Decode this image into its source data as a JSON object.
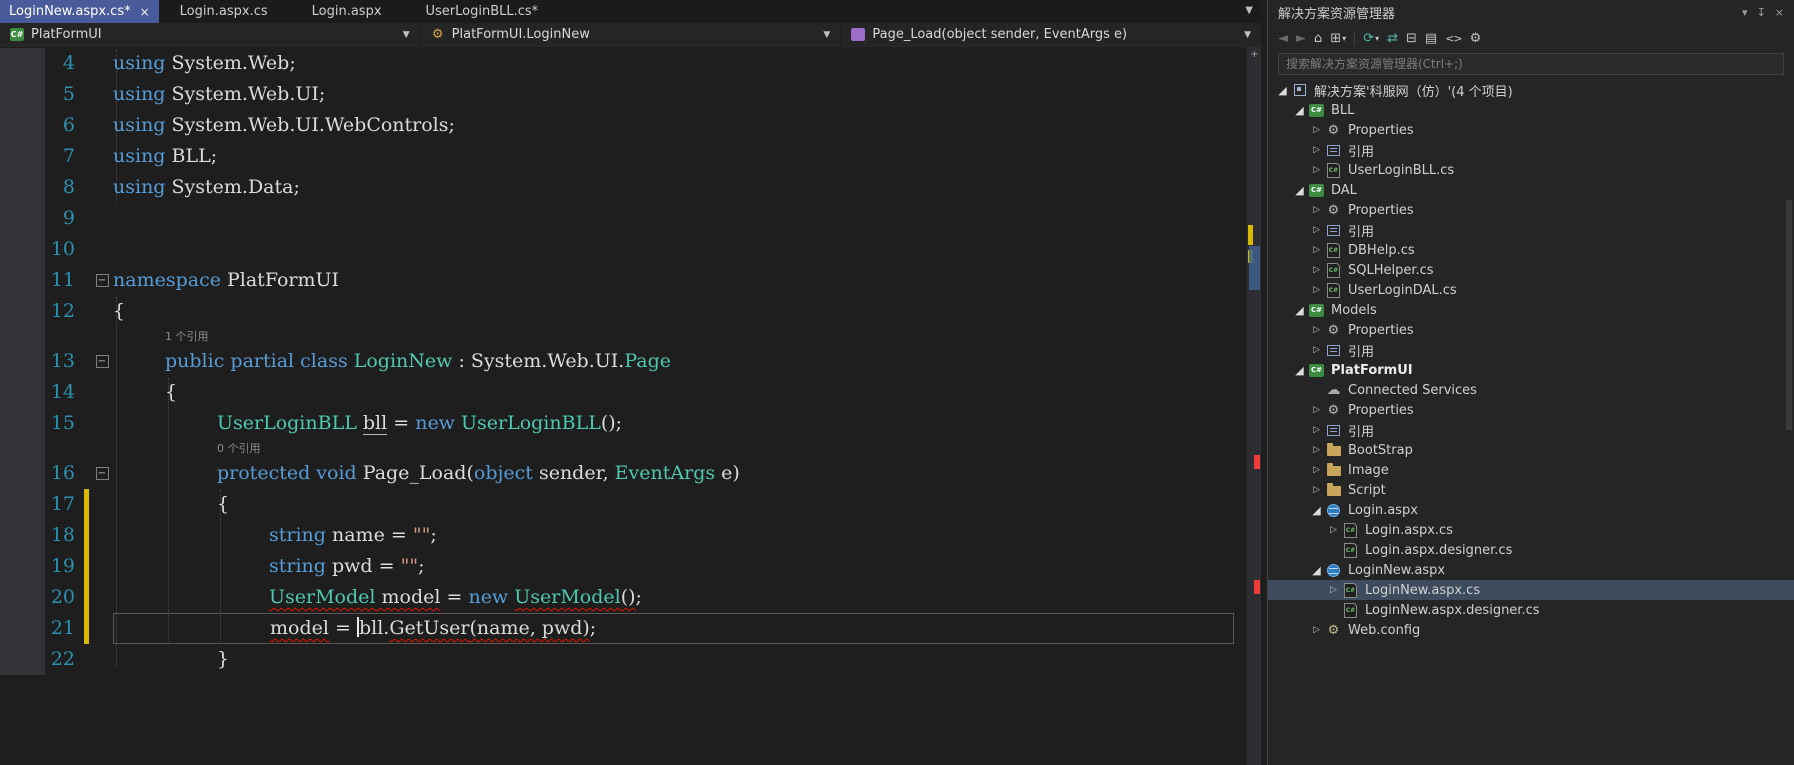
{
  "tabs": {
    "close_glyph": "×",
    "overflow_glyph": "▼",
    "items": [
      {
        "label": "LoginNew.aspx.cs*",
        "active": true
      },
      {
        "label": "Login.aspx.cs",
        "active": false
      },
      {
        "label": "Login.aspx",
        "active": false
      },
      {
        "label": "UserLoginBLL.cs*",
        "active": false
      }
    ]
  },
  "breadcrumbs": [
    {
      "label": "PlatFormUI",
      "icon": "project",
      "icon_glyph": "C#"
    },
    {
      "label": "PlatFormUI.LoginNew",
      "icon": "class",
      "icon_glyph": "⚙"
    },
    {
      "label": "Page_Load(object sender, EventArgs e)",
      "icon": "method",
      "icon_glyph": ""
    }
  ],
  "glyphs": {
    "chevron_down": "▼",
    "mini_caret": "▾",
    "expanded": "◢",
    "collapsed": "▷",
    "fold_minus": "−",
    "scroll_widget": "+"
  },
  "editor": {
    "lines": [
      {
        "num": 4,
        "indent": 0,
        "tokens": [
          [
            "kw",
            "using"
          ],
          [
            "pl",
            " System.Web;"
          ]
        ]
      },
      {
        "num": 5,
        "indent": 0,
        "tokens": [
          [
            "kw",
            "using"
          ],
          [
            "pl",
            " System.Web.UI;"
          ]
        ]
      },
      {
        "num": 6,
        "indent": 0,
        "tokens": [
          [
            "kw",
            "using"
          ],
          [
            "pl",
            " System.Web.UI.WebControls;"
          ]
        ]
      },
      {
        "num": 7,
        "indent": 0,
        "tokens": [
          [
            "kw",
            "using"
          ],
          [
            "pl",
            " BLL;"
          ]
        ]
      },
      {
        "num": 8,
        "indent": 0,
        "tokens": [
          [
            "kw",
            "using"
          ],
          [
            "pl",
            " System.Data;"
          ]
        ]
      },
      {
        "num": 9,
        "indent": 0,
        "tokens": []
      },
      {
        "num": 10,
        "indent": 0,
        "tokens": []
      },
      {
        "num": 11,
        "indent": 0,
        "fold": true,
        "tokens": [
          [
            "kw",
            "namespace"
          ],
          [
            "pl",
            " PlatFormUI"
          ]
        ]
      },
      {
        "num": 12,
        "indent": 0,
        "tokens": [
          [
            "pl",
            "{"
          ]
        ]
      },
      {
        "num": 13,
        "indent": 1,
        "fold": true,
        "codelens": "1 个引用",
        "tokens": [
          [
            "kw",
            "public"
          ],
          [
            "pl",
            " "
          ],
          [
            "kw",
            "partial"
          ],
          [
            "pl",
            " "
          ],
          [
            "kw",
            "class"
          ],
          [
            "pl",
            " "
          ],
          [
            "ty",
            "LoginNew"
          ],
          [
            "pl",
            " : System.Web.UI."
          ],
          [
            "ty",
            "Page"
          ]
        ]
      },
      {
        "num": 14,
        "indent": 1,
        "tokens": [
          [
            "pl",
            "{"
          ]
        ]
      },
      {
        "num": 15,
        "indent": 2,
        "tokens": [
          [
            "ty",
            "UserLoginBLL"
          ],
          [
            "pl",
            " "
          ],
          [
            "pl hl",
            "bll"
          ],
          [
            "pl",
            " = "
          ],
          [
            "kw",
            "new"
          ],
          [
            "pl",
            " "
          ],
          [
            "ty",
            "UserLoginBLL"
          ],
          [
            "pl",
            "();"
          ]
        ]
      },
      {
        "num": 16,
        "indent": 2,
        "fold": true,
        "codelens": "0 个引用",
        "tokens": [
          [
            "kw",
            "protected"
          ],
          [
            "pl",
            " "
          ],
          [
            "kw",
            "void"
          ],
          [
            "pl",
            " Page_Load("
          ],
          [
            "kw",
            "object"
          ],
          [
            "pl",
            " sender, "
          ],
          [
            "ty",
            "EventArgs"
          ],
          [
            "pl",
            " e)"
          ]
        ]
      },
      {
        "num": 17,
        "indent": 2,
        "changed": true,
        "tokens": [
          [
            "pl",
            "{"
          ]
        ]
      },
      {
        "num": 18,
        "indent": 3,
        "changed": true,
        "tokens": [
          [
            "kw",
            "string"
          ],
          [
            "pl",
            " name = "
          ],
          [
            "st",
            "\"\""
          ],
          [
            "pl",
            ";"
          ]
        ]
      },
      {
        "num": 19,
        "indent": 3,
        "changed": true,
        "tokens": [
          [
            "kw",
            "string"
          ],
          [
            "pl",
            " pwd = "
          ],
          [
            "st",
            "\"\""
          ],
          [
            "pl",
            ";"
          ]
        ]
      },
      {
        "num": 20,
        "indent": 3,
        "changed": true,
        "tokens": [
          [
            "ty err",
            "UserModel"
          ],
          [
            "pl err",
            " model"
          ],
          [
            "pl",
            " = "
          ],
          [
            "kw",
            "new"
          ],
          [
            "pl",
            " "
          ],
          [
            "ty err",
            "UserModel"
          ],
          [
            "pl err",
            "()"
          ],
          [
            "pl",
            ";"
          ]
        ]
      },
      {
        "num": 21,
        "indent": 3,
        "changed": true,
        "current": true,
        "tokens": [
          [
            "pl err",
            "model"
          ],
          [
            "pl",
            " = "
          ],
          [
            "caret",
            ""
          ],
          [
            "pl",
            "bll."
          ],
          [
            "pl err",
            "GetUser"
          ],
          [
            "pl err",
            "(name, pwd)"
          ],
          [
            "pl",
            ";"
          ]
        ]
      },
      {
        "num": 22,
        "indent": 2,
        "tokens": [
          [
            "pl",
            "}"
          ]
        ]
      }
    ]
  },
  "solution_explorer": {
    "title": "解决方案资源管理器",
    "search_placeholder": "搜索解决方案资源管理器(Ctrl+;)",
    "title_icons": [
      {
        "name": "chevron-down",
        "glyph": "▾"
      },
      {
        "name": "pin",
        "glyph": "↧"
      },
      {
        "name": "close",
        "glyph": "×"
      }
    ],
    "toolbar": [
      {
        "name": "back",
        "glyph": "◄",
        "style": "dim"
      },
      {
        "name": "forward",
        "glyph": "►",
        "style": "dim"
      },
      {
        "name": "home",
        "glyph": "⌂"
      },
      {
        "name": "switch-views",
        "glyph": "⊞",
        "caret": true
      },
      {
        "separator": true
      },
      {
        "name": "refresh",
        "glyph": "⟳",
        "style": "teal",
        "caret": true
      },
      {
        "name": "sync-with-active-document",
        "glyph": "⇄",
        "style": "teal"
      },
      {
        "name": "collapse-all",
        "glyph": "⊟"
      },
      {
        "name": "show-all-files",
        "glyph": "▤"
      },
      {
        "name": "code-view",
        "glyph": "<>",
        "style": "codeview"
      },
      {
        "name": "properties",
        "glyph": "⚙"
      }
    ],
    "icon_glyphs": {
      "csproj": "C#",
      "webproj": "C#",
      "csfile": "C#",
      "properties": "⚙",
      "config": "⚙",
      "cloud": "☁"
    },
    "tree": [
      {
        "label": "解决方案'科服网（仿）'(4 个项目)",
        "indent": 0,
        "expand": "expanded",
        "icon": "solution"
      },
      {
        "label": "BLL",
        "indent": 1,
        "expand": "expanded",
        "icon": "csproj"
      },
      {
        "label": "Properties",
        "indent": 2,
        "expand": "collapsed",
        "icon": "properties"
      },
      {
        "label": "引用",
        "indent": 2,
        "expand": "collapsed",
        "icon": "references"
      },
      {
        "label": "UserLoginBLL.cs",
        "indent": 2,
        "expand": "collapsed",
        "icon": "csfile"
      },
      {
        "label": "DAL",
        "indent": 1,
        "expand": "expanded",
        "icon": "csproj"
      },
      {
        "label": "Properties",
        "indent": 2,
        "expand": "collapsed",
        "icon": "properties"
      },
      {
        "label": "引用",
        "indent": 2,
        "expand": "collapsed",
        "icon": "references"
      },
      {
        "label": "DBHelp.cs",
        "indent": 2,
        "expand": "collapsed",
        "icon": "csfile"
      },
      {
        "label": "SQLHelper.cs",
        "indent": 2,
        "expand": "collapsed",
        "icon": "csfile"
      },
      {
        "label": "UserLoginDAL.cs",
        "indent": 2,
        "expand": "collapsed",
        "icon": "csfile"
      },
      {
        "label": "Models",
        "indent": 1,
        "expand": "expanded",
        "icon": "csproj"
      },
      {
        "label": "Properties",
        "indent": 2,
        "expand": "collapsed",
        "icon": "properties"
      },
      {
        "label": "引用",
        "indent": 2,
        "expand": "collapsed",
        "icon": "references"
      },
      {
        "label": "PlatFormUI",
        "indent": 1,
        "expand": "expanded",
        "icon": "webproj",
        "bold": true
      },
      {
        "label": "Connected Services",
        "indent": 2,
        "expand": null,
        "icon": "cloud"
      },
      {
        "label": "Properties",
        "indent": 2,
        "expand": "collapsed",
        "icon": "properties"
      },
      {
        "label": "引用",
        "indent": 2,
        "expand": "collapsed",
        "icon": "references"
      },
      {
        "label": "BootStrap",
        "indent": 2,
        "expand": "collapsed",
        "icon": "folder"
      },
      {
        "label": "Image",
        "indent": 2,
        "expand": "collapsed",
        "icon": "folder"
      },
      {
        "label": "Script",
        "indent": 2,
        "expand": "collapsed",
        "icon": "folder"
      },
      {
        "label": "Login.aspx",
        "indent": 2,
        "expand": "expanded",
        "icon": "aspx"
      },
      {
        "label": "Login.aspx.cs",
        "indent": 3,
        "expand": "collapsed",
        "icon": "csfile"
      },
      {
        "label": "Login.aspx.designer.cs",
        "indent": 3,
        "expand": null,
        "icon": "csfile"
      },
      {
        "label": "LoginNew.aspx",
        "indent": 2,
        "expand": "expanded",
        "icon": "aspx"
      },
      {
        "label": "LoginNew.aspx.cs",
        "indent": 3,
        "expand": "collapsed",
        "icon": "csfile",
        "selected": true
      },
      {
        "label": "LoginNew.aspx.designer.cs",
        "indent": 3,
        "expand": null,
        "icon": "csfile"
      },
      {
        "label": "Web.config",
        "indent": 2,
        "expand": "collapsed",
        "icon": "config"
      }
    ]
  },
  "colors": {
    "active_tab": "#4A5B9C",
    "keyword": "#569CD6",
    "type": "#4EC9B0",
    "string": "#D69D85",
    "line_number": "#2B91AF",
    "error_squiggle": "#E51400",
    "changed_bar": "#D7BA00",
    "editor_bg": "#1E1E1E",
    "panel_bg": "#252526",
    "selected_row": "#3D4B5D"
  }
}
